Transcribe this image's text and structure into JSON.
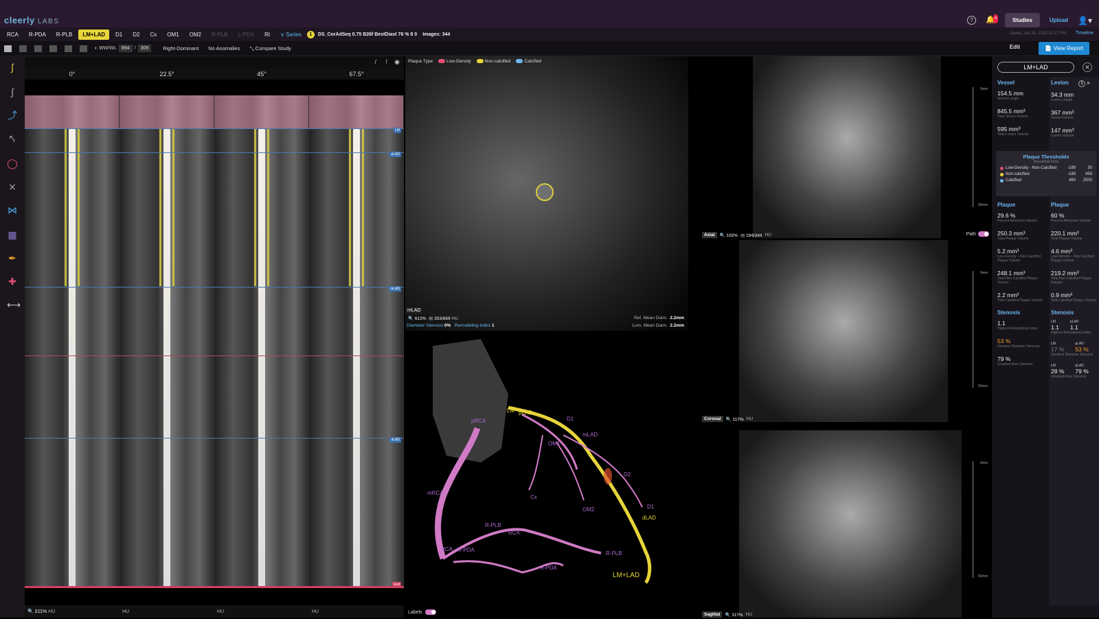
{
  "app": {
    "logo_main": "cleerly",
    "logo_sub": "LABS"
  },
  "top": {
    "help": "?",
    "notif_count": "8",
    "studies": "Studies",
    "upload": "Upload"
  },
  "vessels": [
    {
      "label": "RCA",
      "state": "normal"
    },
    {
      "label": "R-PDA",
      "state": "normal"
    },
    {
      "label": "R-PLB",
      "state": "normal"
    },
    {
      "label": "LM+LAD",
      "state": "active"
    },
    {
      "label": "D1",
      "state": "normal"
    },
    {
      "label": "D2",
      "state": "normal"
    },
    {
      "label": "Cx",
      "state": "normal"
    },
    {
      "label": "OM1",
      "state": "normal"
    },
    {
      "label": "OM2",
      "state": "normal"
    },
    {
      "label": "R-PLB",
      "state": "dim"
    },
    {
      "label": "L-PDA",
      "state": "dim"
    },
    {
      "label": "RI",
      "state": "normal"
    }
  ],
  "series": {
    "label": "Series",
    "badge": "1",
    "name": "DS_CorAdSeq 0.75 B26f BestDiast 76 % 8 0",
    "images": "Images: 344"
  },
  "saved": "Saved: Jan 31, 2025 12:27 PM",
  "timeline": "Timeline",
  "toolbar": {
    "wwwl": "WW/WL",
    "ww": "894",
    "wl": "309",
    "dominance": "Right-Dominant",
    "anomalies": "No Anomalies",
    "compare": "Compare Study",
    "edit": "Edit",
    "view_report": "View Report"
  },
  "cpr": {
    "angles": [
      "0°",
      "22.5°",
      "45°",
      "67.5°"
    ],
    "tags": [
      "LM",
      "pLAD",
      "mLAD",
      "dLAD",
      "End"
    ],
    "zoom": "211%",
    "hu": "HU"
  },
  "xsection": {
    "plaque_type": "Plaque Type",
    "legend": [
      {
        "name": "Low-Density",
        "color": "#e05070"
      },
      {
        "name": "Non-calcified",
        "color": "#e6d43a"
      },
      {
        "name": "Calcified",
        "color": "#6cb8f0"
      }
    ],
    "segment": "mLAD",
    "zoom": "613%",
    "slice": "353/669",
    "hu": "HU",
    "diameter_stenosis_label": "Diameter Stenosis",
    "diameter_stenosis": "0%",
    "remodeling_label": "Remodeling Index",
    "remodeling": "1",
    "ref_mean_label": "Ref. Mean Diam.",
    "ref_mean": "2.2mm",
    "lum_mean_label": "Lum. Mean Diam.",
    "lum_mean": "2.2mm"
  },
  "v3d": {
    "labels": [
      "pRCA",
      "LM",
      "pLAD",
      "D1",
      "OM1",
      "mLAD",
      "D2",
      "D1",
      "Cx",
      "OM2",
      "mRCA",
      "R-PLB",
      "RCA",
      "RCA",
      "R-PDA",
      "R-PLB",
      "R-PDA",
      "LM+LAD",
      "dLAD"
    ],
    "toggle_label": "Labels"
  },
  "axial": {
    "label": "Axial",
    "zoom": "102%",
    "slice": "194/344",
    "hu": "HU",
    "path": "Path",
    "r_top": "0mm",
    "r_bot": "95mm"
  },
  "coronal": {
    "label": "Coronal",
    "zoom": "117%",
    "hu": "HU",
    "r_top": "0mm",
    "r_bot": "83mm"
  },
  "sagittal": {
    "label": "Sagittal",
    "zoom": "117%",
    "hu": "HU",
    "r_top": "0mm",
    "r_bot": "83mm"
  },
  "panel": {
    "title": "LM+LAD",
    "vessel_head": "Vessel",
    "lesion_head": "Lesion",
    "lesion_num": "1",
    "vessel_stats": [
      {
        "v": "154.5 mm",
        "l": "Vessel Length"
      },
      {
        "v": "845.5 mm³",
        "l": "Total Vessel Volume"
      },
      {
        "v": "595 mm³",
        "l": "Total Lumen Volume"
      }
    ],
    "lesion_stats": [
      {
        "v": "34.3 mm",
        "l": "Lesion Length"
      },
      {
        "v": "367 mm³",
        "l": "Vessel Volume"
      },
      {
        "v": "147 mm³",
        "l": "Lumen Volume"
      }
    ],
    "thresholds": {
      "title": "Plaque Thresholds",
      "sub": "Hounsfield Units",
      "rows": [
        {
          "name": "Low-Density - Non-Calcified",
          "a": "-189",
          "b": "30",
          "color": "#e05070"
        },
        {
          "name": "Non-calcified",
          "a": "-189",
          "b": "459",
          "color": "#e6d43a"
        },
        {
          "name": "Calcified",
          "a": "460",
          "b": "2500",
          "color": "#6cb8f0"
        }
      ]
    },
    "plaque_head": "Plaque",
    "vessel_plaque": [
      {
        "v": "29.6 %",
        "l": "Percent Atheroma Volume"
      },
      {
        "v": "250.3 mm³",
        "l": "Total Plaque Volume"
      },
      {
        "v": "5.2 mm³",
        "l": "Low-Density – Non-Calcified Plaque Volume"
      },
      {
        "v": "248.1 mm³",
        "l": "Total Non-Calcified Plaque Volume"
      },
      {
        "v": "2.2 mm³",
        "l": "Total Calcified Plaque Volume"
      }
    ],
    "lesion_plaque": [
      {
        "v": "60 %",
        "l": "Percent Atheroma Volume"
      },
      {
        "v": "220.1 mm³",
        "l": "Total Plaque Volume"
      },
      {
        "v": "4.6 mm³",
        "l": "Low-Density – Non-Calcified Plaque Volume"
      },
      {
        "v": "219.2 mm³",
        "l": "Total Non-Calcified Plaque Volume"
      },
      {
        "v": "0.9 mm³",
        "l": "Total Calcified Plaque Volume"
      }
    ],
    "stenosis_head": "Stenosis",
    "vessel_stenosis": [
      {
        "v": "1.1",
        "l": "Highest Remodeling Index"
      },
      {
        "v": "53 %",
        "l": "Greatest Diameter Stenosis"
      },
      {
        "v": "79 %",
        "l": "Greatest Area Stenosis"
      }
    ],
    "lesion_stenosis": {
      "remod": {
        "lm": "LM",
        "lm_v": "1.1",
        "plad": "pLAD",
        "plad_v": "1.1",
        "l": "Highest Remodeling Index"
      },
      "diam": {
        "lm": "LM",
        "lm_v": "17 %",
        "plad": "pLAD",
        "plad_v": "53 %",
        "l": "Greatest Diameter Stenosis"
      },
      "area": {
        "lm": "LM",
        "lm_v": "28 %",
        "plad": "pLAD",
        "plad_v": "79 %",
        "l": "Greatest Area Stenosis"
      }
    }
  }
}
